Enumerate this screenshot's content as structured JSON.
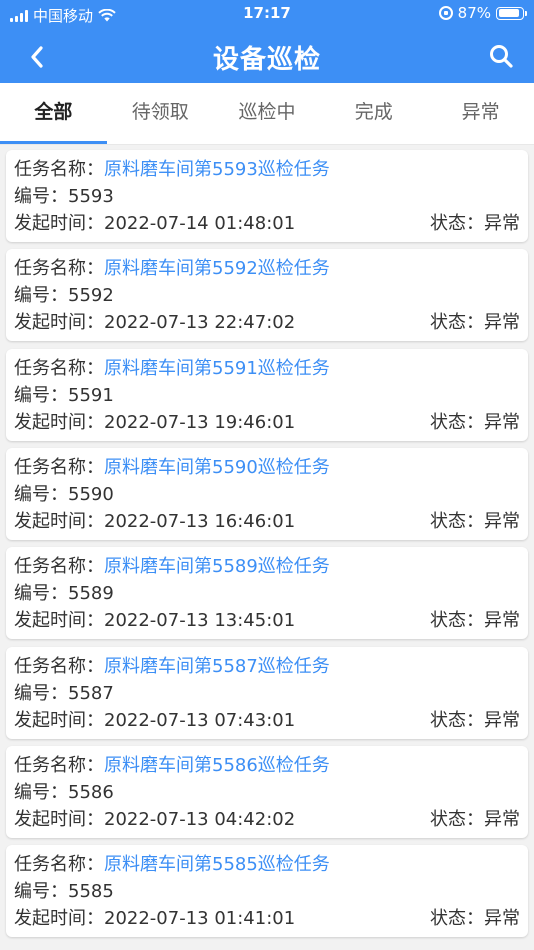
{
  "status_bar": {
    "carrier": "中国移动",
    "time": "17:17",
    "battery": "87%",
    "battery_level": 0.87
  },
  "nav": {
    "title": "设备巡检",
    "back_icon": "chevron-left-icon",
    "search_icon": "search-icon"
  },
  "tabs": [
    {
      "label": "全部",
      "active": true
    },
    {
      "label": "待领取",
      "active": false
    },
    {
      "label": "巡检中",
      "active": false
    },
    {
      "label": "完成",
      "active": false
    },
    {
      "label": "异常",
      "active": false
    }
  ],
  "labels": {
    "task_name": "任务名称：",
    "number": "编号：",
    "start_time": "发起时间：",
    "status": "状态："
  },
  "tasks": [
    {
      "name": "原料磨车间第5593巡检任务",
      "id": "5593",
      "time": "2022-07-14 01:48:01",
      "status": "异常"
    },
    {
      "name": "原料磨车间第5592巡检任务",
      "id": "5592",
      "time": "2022-07-13 22:47:02",
      "status": "异常"
    },
    {
      "name": "原料磨车间第5591巡检任务",
      "id": "5591",
      "time": "2022-07-13 19:46:01",
      "status": "异常"
    },
    {
      "name": "原料磨车间第5590巡检任务",
      "id": "5590",
      "time": "2022-07-13 16:46:01",
      "status": "异常"
    },
    {
      "name": "原料磨车间第5589巡检任务",
      "id": "5589",
      "time": "2022-07-13 13:45:01",
      "status": "异常"
    },
    {
      "name": "原料磨车间第5587巡检任务",
      "id": "5587",
      "time": "2022-07-13 07:43:01",
      "status": "异常"
    },
    {
      "name": "原料磨车间第5586巡检任务",
      "id": "5586",
      "time": "2022-07-13 04:42:02",
      "status": "异常"
    },
    {
      "name": "原料磨车间第5585巡检任务",
      "id": "5585",
      "time": "2022-07-13 01:41:01",
      "status": "异常"
    }
  ],
  "colors": {
    "primary": "#3d8ff5",
    "background": "#f2f2f2"
  }
}
